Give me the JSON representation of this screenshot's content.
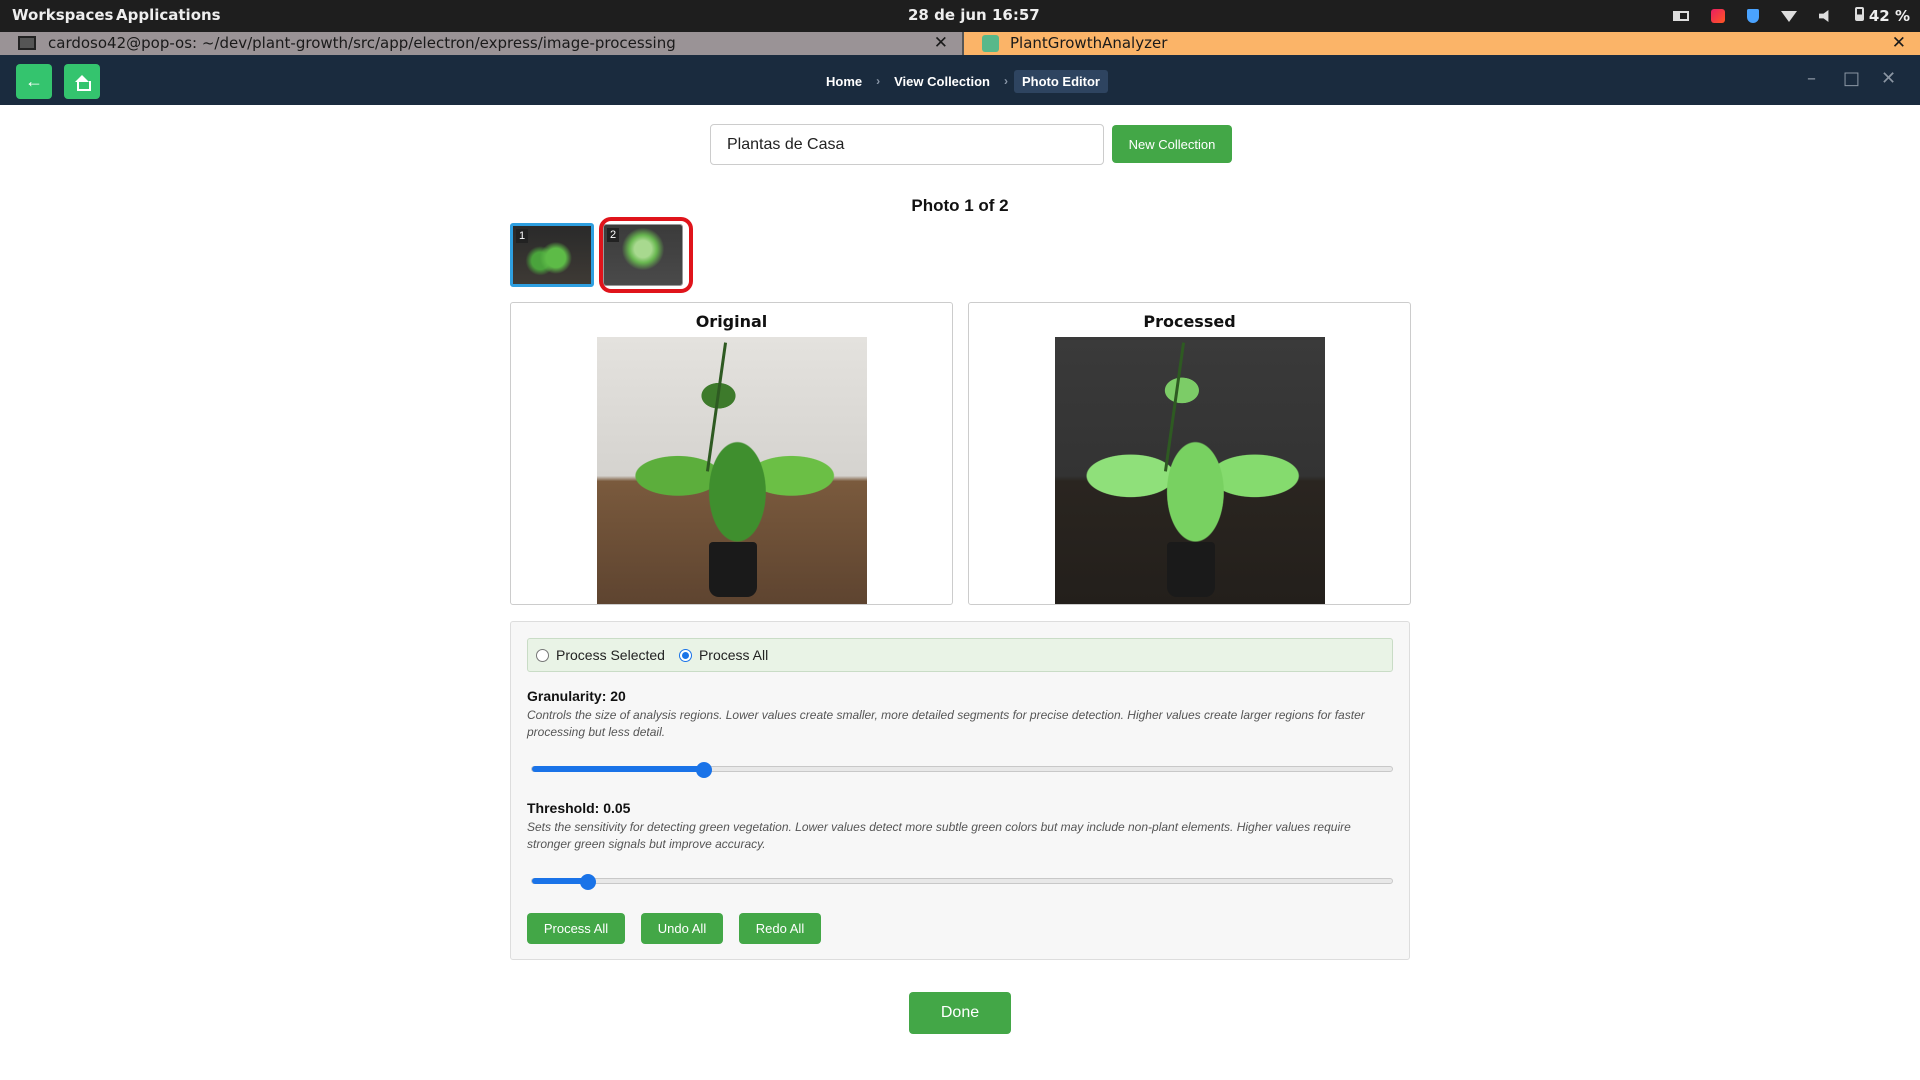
{
  "system_bar": {
    "workspaces": "Workspaces",
    "applications": "Applications",
    "clock": "28 de jun  16:57",
    "battery": "42 %",
    "tray_icons": [
      "layout-icon",
      "color-picker-icon",
      "vpn-shield-icon",
      "wifi-icon",
      "volume-icon",
      "battery-icon"
    ]
  },
  "window_tabs": [
    {
      "title": "cardoso42@pop-os: ~/dev/plant-growth/src/app/electron/express/image-processing",
      "close": "✕",
      "active": false
    },
    {
      "title": "PlantGrowthAnalyzer",
      "close": "✕",
      "active": true
    }
  ],
  "header": {
    "back_label": "←",
    "breadcrumbs": [
      {
        "label": "Home"
      },
      {
        "label": "View Collection"
      },
      {
        "label": "Photo Editor",
        "active": true
      }
    ],
    "separator": "›",
    "window_controls": {
      "minimize": "–",
      "maximize": "□",
      "close": "✕"
    }
  },
  "collection": {
    "name_value": "Plantas de Casa",
    "new_collection_label": "New Collection"
  },
  "photo_counter": "Photo 1 of 2",
  "thumbnails": [
    {
      "number": "1",
      "selected": true
    },
    {
      "number": "2",
      "selected": false,
      "highlighted": true
    }
  ],
  "panels": {
    "original_title": "Original",
    "processed_title": "Processed"
  },
  "controls": {
    "radio_process_selected": "Process Selected",
    "radio_process_all": "Process All",
    "radio_checked": "process_all",
    "granularity": {
      "label": "Granularity: 20",
      "description": "Controls the size of analysis regions. Lower values create smaller, more detailed segments for precise detection. Higher values create larger regions for faster processing but less detail.",
      "level_fraction": 0.2
    },
    "threshold": {
      "label": "Threshold: 0.05",
      "description": "Sets the sensitivity for detecting green vegetation. Lower values detect more subtle green colors but may include non-plant elements. Higher values require stronger green signals but improve accuracy.",
      "level_fraction": 0.065
    },
    "buttons": {
      "process_all": "Process All",
      "undo_all": "Undo All",
      "redo_all": "Redo All"
    }
  },
  "done_label": "Done",
  "colors": {
    "accent_green": "#43a747",
    "header_bg": "#1a2b3e",
    "slider_blue": "#1a73e8",
    "highlight_red": "#e0141b"
  }
}
